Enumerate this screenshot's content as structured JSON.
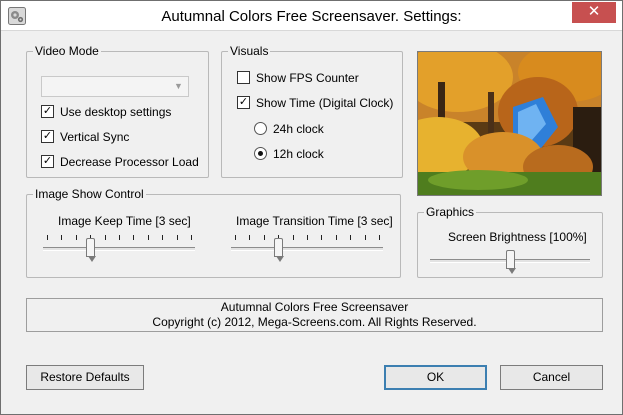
{
  "window": {
    "title": "Autumnal Colors Free Screensaver. Settings:",
    "close_glyph": "✕"
  },
  "video_mode": {
    "legend": "Video Mode",
    "resolution_select_value": "",
    "use_desktop": {
      "label": "Use desktop settings",
      "checked": true
    },
    "vsync": {
      "label": "Vertical Sync",
      "checked": true
    },
    "decrease_load": {
      "label": "Decrease Processor Load",
      "checked": true
    }
  },
  "visuals": {
    "legend": "Visuals",
    "show_fps": {
      "label": "Show FPS Counter",
      "checked": false
    },
    "show_time": {
      "label": "Show Time (Digital Clock)",
      "checked": true
    },
    "clock_24h": {
      "label": "24h clock",
      "selected": false
    },
    "clock_12h": {
      "label": "12h clock",
      "selected": true
    }
  },
  "image_show": {
    "legend": "Image Show Control",
    "keep_time": {
      "label": "Image Keep Time [3 sec]",
      "value": 3,
      "min": 0,
      "max": 10
    },
    "transition_time": {
      "label": "Image Transition Time [3 sec]",
      "value": 3,
      "min": 0,
      "max": 10
    }
  },
  "graphics": {
    "legend": "Graphics",
    "brightness": {
      "label": "Screen Brightness [100%]",
      "value_fraction": 0.5
    }
  },
  "info": {
    "line1": "Autumnal Colors Free Screensaver",
    "line2": "Copyright (c) 2012, Mega-Screens.com. All Rights Reserved."
  },
  "buttons": {
    "restore": "Restore Defaults",
    "ok": "OK",
    "cancel": "Cancel"
  },
  "icons": {
    "app": "gear-icon",
    "checkmark": "✓"
  },
  "colors": {
    "close_button": "#c75050",
    "default_button_border": "#3c7fb1"
  }
}
